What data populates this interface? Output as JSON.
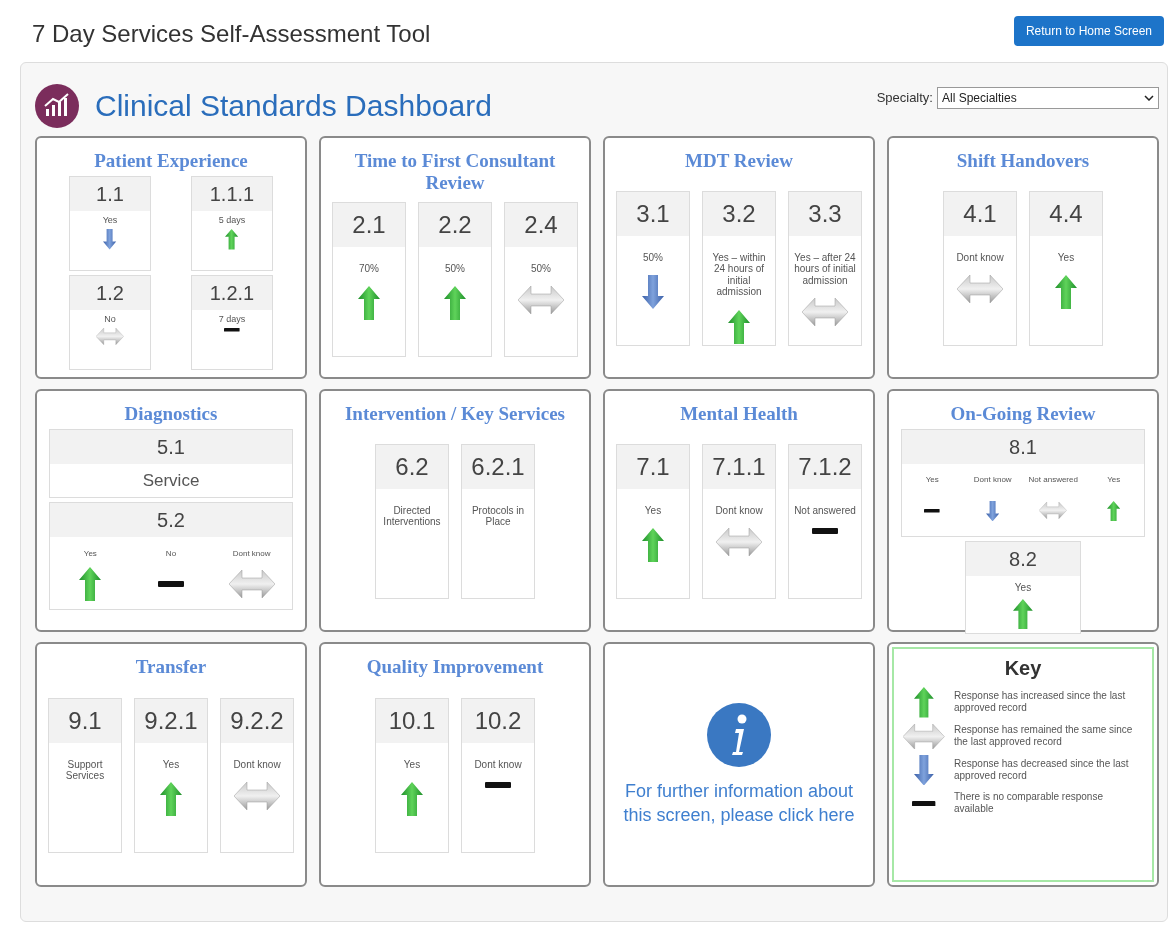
{
  "header": {
    "title": "7 Day Services Self-Assessment Tool",
    "button": "Return to Home Screen"
  },
  "dashboard": {
    "title": "Clinical Standards Dashboard",
    "specialty_label": "Specialty:",
    "specialty_value": "All Specialties"
  },
  "panels": [
    {
      "title": "Patient Experience",
      "kind": "grid",
      "tiles": [
        {
          "code": "1.1",
          "label": "Yes",
          "kind": "down"
        },
        {
          "code": "1.1.1",
          "label": "5 days",
          "kind": "up"
        },
        {
          "code": "1.2",
          "label": "No",
          "kind": "same"
        },
        {
          "code": "1.2.1",
          "label": "7 days",
          "kind": "none"
        }
      ]
    },
    {
      "title": "Time to First Consultant Review",
      "kind": "row",
      "tiles": [
        {
          "code": "2.1",
          "label": "70%",
          "kind": "up"
        },
        {
          "code": "2.2",
          "label": "50%",
          "kind": "up"
        },
        {
          "code": "2.4",
          "label": "50%",
          "kind": "same"
        }
      ]
    },
    {
      "title": "MDT Review",
      "kind": "row",
      "tiles": [
        {
          "code": "3.1",
          "label": "50%",
          "kind": "down"
        },
        {
          "code": "3.2",
          "label": "Yes – within 24 hours of initial admission",
          "kind": "up"
        },
        {
          "code": "3.3",
          "label": "Yes – after 24 hours of initial admission",
          "kind": "same"
        }
      ]
    },
    {
      "title": "Shift Handovers",
      "kind": "row",
      "tiles": [
        {
          "code": "4.1",
          "label": "Dont know",
          "kind": "same"
        },
        {
          "code": "4.4",
          "label": "Yes",
          "kind": "up"
        }
      ]
    },
    {
      "title": "Diagnostics",
      "kind": "stack",
      "tiles": [
        {
          "code": "5.1",
          "label": "Service",
          "wide": true
        },
        {
          "code": "5.2",
          "wide": true,
          "responses": [
            {
              "label": "Yes",
              "kind": "up"
            },
            {
              "label": "No",
              "kind": "none"
            },
            {
              "label": "Dont know",
              "kind": "same"
            }
          ]
        }
      ]
    },
    {
      "title": "Intervention / Key Services",
      "kind": "row",
      "tiles": [
        {
          "code": "6.2",
          "label": "Directed Interventions"
        },
        {
          "code": "6.2.1",
          "label": "Protocols in Place"
        }
      ]
    },
    {
      "title": "Mental Health",
      "kind": "row",
      "tiles": [
        {
          "code": "7.1",
          "label": "Yes",
          "kind": "up"
        },
        {
          "code": "7.1.1",
          "label": "Dont know",
          "kind": "same"
        },
        {
          "code": "7.1.2",
          "label": "Not answered",
          "kind": "none"
        }
      ]
    },
    {
      "title": "On-Going Review",
      "kind": "stack",
      "tiles": [
        {
          "code": "8.1",
          "wide": true,
          "responses": [
            {
              "label": "Yes",
              "kind": "none"
            },
            {
              "label": "Dont know",
              "kind": "down"
            },
            {
              "label": "Not answered",
              "kind": "same"
            },
            {
              "label": "Yes",
              "kind": "up"
            }
          ]
        },
        {
          "code": "8.2",
          "label": "Yes",
          "kind": "up",
          "wide": false
        }
      ]
    },
    {
      "title": "Transfer",
      "kind": "row",
      "tiles": [
        {
          "code": "9.1",
          "label": "Support Services"
        },
        {
          "code": "9.2.1",
          "label": "Yes",
          "kind": "up"
        },
        {
          "code": "9.2.2",
          "label": "Dont know",
          "kind": "same"
        }
      ]
    },
    {
      "title": "Quality Improvement",
      "kind": "row",
      "tiles": [
        {
          "code": "10.1",
          "label": "Yes",
          "kind": "up"
        },
        {
          "code": "10.2",
          "label": "Dont know",
          "kind": "none"
        }
      ]
    },
    {
      "kind": "info",
      "text": "For further information about this screen, please click here"
    },
    {
      "kind": "key",
      "title": "Key",
      "entries": [
        {
          "kind": "up",
          "text": "Response has increased since the last approved record"
        },
        {
          "kind": "same",
          "text": "Response has remained the same since the last approved record"
        },
        {
          "kind": "down",
          "text": "Response has decreased since the last approved record"
        },
        {
          "kind": "none",
          "text": "There is no comparable response available"
        }
      ]
    }
  ]
}
